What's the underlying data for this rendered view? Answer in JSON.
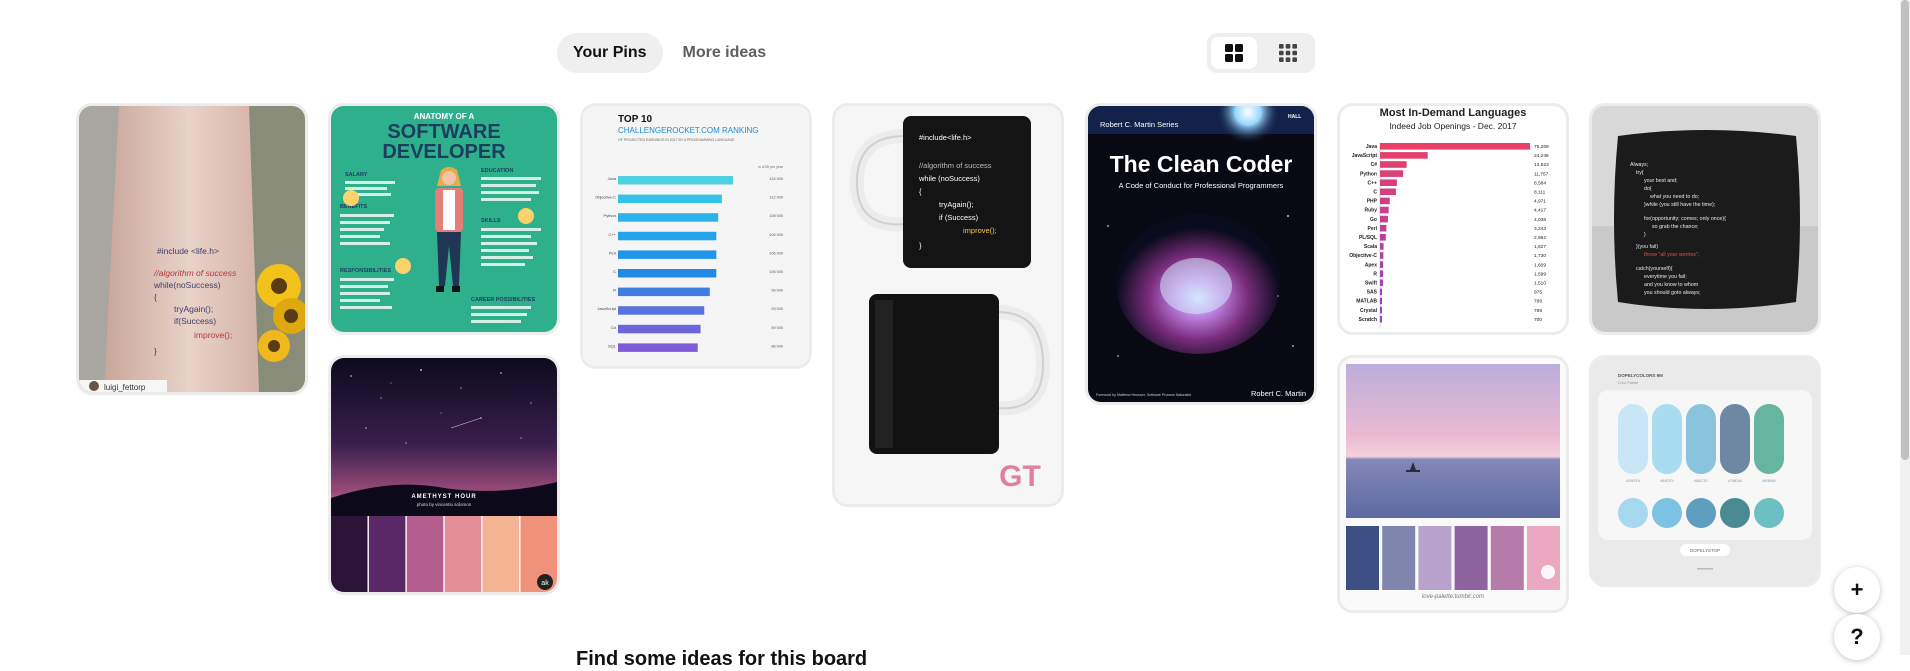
{
  "tabs": {
    "your_pins": "Your Pins",
    "more_ideas": "More ideas"
  },
  "view_toggle": {
    "default_icon": "grid-default-icon",
    "compact_icon": "grid-compact-icon"
  },
  "pins": {
    "tattoo": {
      "lines": [
        "#include <life.h>",
        "//algorithm of success",
        "while(noSuccess)",
        "{",
        "tryAgain();",
        "if(Success)",
        "improve();",
        "}"
      ],
      "user_label": "luigi_fettorp"
    },
    "software_dev": {
      "title1": "ANATOMY OF A",
      "title2": "SOFTWARE",
      "title3": "DEVELOPER",
      "salary": "SALARY",
      "education": "EDUCATION",
      "benefits": "BENEFITS",
      "skills": "SKILLS",
      "responsibilities": "RESPONSIBILITIES",
      "career": "CAREER POSSIBILITIES"
    },
    "ranking": {
      "title": "TOP 10",
      "subtitle": "CHALLENGEROCKET.COM RANKING",
      "note": "OF PROJECTED EARNINGS IN 2017 BY A PROGRAMMING LANGUAGE",
      "unit": "in USD per year",
      "langs": [
        "Java",
        "Objective-C",
        "Python",
        "C++",
        "Perl",
        "C",
        "R",
        "JavaScript",
        "C#",
        "SQL"
      ],
      "values": [
        "124 000",
        "112 000",
        "108 000",
        "106 000",
        "106 000",
        "106 000",
        "99 000",
        "93 000",
        "89 000",
        "86 000"
      ]
    },
    "mug": {
      "lines": [
        "#include<life.h>",
        "",
        "//algorithm of success",
        "while (noSuccess)",
        "{",
        "tryAgain();",
        "if (Success)",
        "improve();",
        "}"
      ],
      "brand": "GT"
    },
    "clean_coder": {
      "series": "Robert C. Martin Series",
      "title": "The Clean Coder",
      "subtitle": "A Code of Conduct for Professional Programmers",
      "foreword": "Foreword by Matthew Heusser, Software Process Naturalist",
      "author": "Robert C. Martin",
      "publisher": "HALL"
    },
    "languages": {
      "title": "Most In-Demand Languages",
      "subtitle": "Indeed Job Openings - Dec. 2017",
      "labels": [
        "Java",
        "JavaScript",
        "C#",
        "Python",
        "C++",
        "C",
        "PHP",
        "Ruby",
        "Go",
        "Perl",
        "PL/SQL",
        "Scala",
        "Objective-C",
        "Apex",
        "R",
        "Swift",
        "SAS",
        "MATLAB",
        "Crystal",
        "Scratch"
      ],
      "values": [
        "76,269",
        "24,248",
        "13,523",
        "11,757",
        "8,584",
        "8,111",
        "4,971",
        "4,417",
        "4,038",
        "3,243",
        "2,962",
        "1,827",
        "1,730",
        "1,609",
        "1,599",
        "1,510",
        "975",
        "789",
        "789",
        "700"
      ]
    },
    "pillow": {
      "lines": [
        "Always;",
        "try{",
        "your best and;",
        "do{",
        "what you need to do;",
        "}while (you still have the time);",
        "for(opportunity; comes; only once){",
        "so grab the chance;",
        "}",
        "}(you fail)",
        "throw \"all your worries\";",
        "catch(yourself){",
        "everytime you fail;",
        "and you know to whom",
        "you should goto always;"
      ]
    },
    "amethyst": {
      "title": "AMETHYST HOUR",
      "credit": "photo by vincentiu solomon",
      "badge": "ak"
    },
    "seascape": {
      "caption": "love-palette.tumblr.com"
    },
    "dopely": {
      "brand": "DOPELYCOLORS 9M",
      "sub": "Color Palette",
      "button": "DOPELYSTOP",
      "swatch_labels": [
        "#D9ECFA",
        "#B4E2F4",
        "#8BC7E0",
        "#708DA8",
        "#6FB9A5"
      ]
    }
  },
  "colors": {
    "palette_amethyst": [
      "#2c1338",
      "#5b2867",
      "#b45e8f",
      "#e48e98",
      "#f4b493",
      "#f0917c"
    ],
    "palette_seascape": [
      "#3e4f86",
      "#8085ad",
      "#b7a3cd",
      "#8f62a0",
      "#b47bab",
      "#eaa9c0"
    ],
    "palette_dopely_top": [
      "#c9e6f7",
      "#a9dcf1",
      "#8ac3dc",
      "#6e87a2",
      "#66b5a0"
    ],
    "palette_dopely_bottom": [
      "#a6d8ef",
      "#7cc3e2",
      "#5f9fbd",
      "#4a8a93",
      "#6cc0c3"
    ]
  },
  "fabs": {
    "add_label": "+",
    "help_label": "?"
  },
  "bottom_heading": "Find some ideas for this board"
}
